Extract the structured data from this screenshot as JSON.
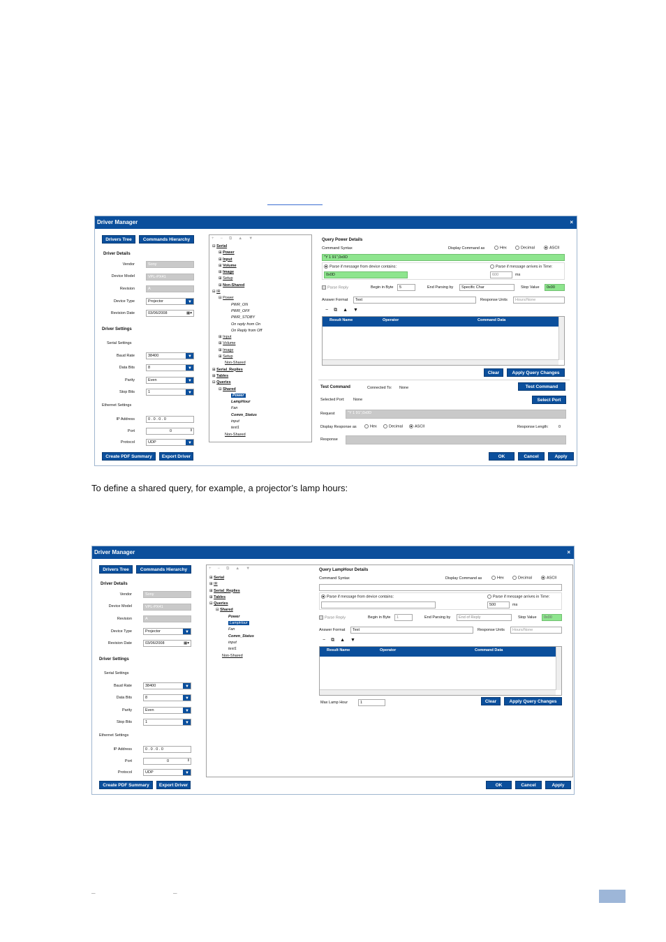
{
  "link_text": "",
  "intro_text": "To define a shared query, for example, a projector’s lamp hours:",
  "footer": {
    "left_a": "–",
    "left_b": "–"
  },
  "win1": {
    "title": "Driver Manager",
    "close": "×",
    "tab_drivers": "Drivers Tree",
    "tab_commands": "Commands Hierarchy",
    "driver_details": "Driver Details",
    "vendor_label": "Vendor",
    "vendor": "Sony",
    "model_label": "Device Model",
    "model": "VPL-PX41",
    "revision_label": "Revision",
    "revision": "A",
    "type_label": "Device Type",
    "type": "Projector",
    "date_label": "Revision Date",
    "date": "03/06/2008",
    "driver_settings": "Driver Settings",
    "serial_settings": "Serial Settings",
    "baud_label": "Baud Rate",
    "baud": "38400",
    "databits_label": "Data Bits",
    "databits": "8",
    "parity_label": "Parity",
    "parity": "Even",
    "stopbits_label": "Stop Bits",
    "stopbits": "1",
    "ethernet_settings": "Ethernet Settings",
    "ip_label": "IP Address",
    "ip": "0 . 0 . 0 . 0",
    "port_label": "Port",
    "port": "0",
    "protocol_label": "Protocol",
    "protocol": "UDP",
    "btn_pdf": "Create PDF Summary",
    "btn_export": "Export Driver",
    "tree": [
      "Serial",
      "Power",
      "Input",
      "Volume",
      "Image",
      "Setup",
      "Non-Shared",
      "IR",
      "Power",
      "PWR_ON",
      "PWR_OFF",
      "PWR_STDBY",
      "On reply from On",
      "On Reply from Off",
      "Input",
      "Volume",
      "Image",
      "Setup",
      "Non-Shared",
      "Serial_Replies",
      "Tables",
      "Queries",
      "Shared",
      "Power",
      "LampHour",
      "Fan",
      "Comm_Status",
      "input",
      "test1",
      "Non-Shared"
    ],
    "qd_title": "Query Power Details",
    "cmd_syntax": "Command Syntax",
    "display_as": "Display Command as",
    "hex": "Hex",
    "decimal": "Decimal",
    "ascii": "ASCII",
    "syntax_value": "\"Y 1 91\",0x0D",
    "parse_contains": "Parse if message from device contains:",
    "contains_value": "0x0D",
    "parse_time": "Parse if message arrives in Time:",
    "time_value": "600",
    "ms": "ms",
    "parse_reply": "Parse Reply",
    "begin_byte": "Begin in Byte",
    "begin_value": "5",
    "end_parsing": "End Parsing by",
    "end_value": "Specific Char",
    "stop_value_label": "Stop Value",
    "stop_value": "0x00",
    "answer_format": "Answer Format",
    "answer_value": "Text",
    "response_units": "Response Units",
    "response_value": "Hours/None",
    "col_result": "Result Name",
    "col_operator": "Operator",
    "col_data": "Command Data",
    "btn_clear": "Clear",
    "btn_apply_query": "Apply Query Changes",
    "test_command": "Test Command",
    "connected_to": "Connected To:",
    "connected_value": "None",
    "btn_test": "Test Command",
    "selected_port": "Selected Port:",
    "port_value": "None",
    "btn_select_port": "Select Port",
    "request_label": "Request",
    "request_value": "\"Y 1 91\",0x0D",
    "display_response": "Display Response as",
    "response_length": "Response Length:",
    "length_value": "0",
    "response_label": "Response",
    "btn_ok": "OK",
    "btn_cancel": "Cancel",
    "btn_apply": "Apply"
  },
  "win2": {
    "title": "Driver Manager",
    "close": "×",
    "tab_drivers": "Drivers Tree",
    "tab_commands": "Commands Hierarchy",
    "driver_details": "Driver Details",
    "vendor_label": "Vendor",
    "vendor": "Sony",
    "model_label": "Device Model",
    "model": "VPL-PX41",
    "revision_label": "Revision",
    "revision": "A",
    "type_label": "Device Type",
    "type": "Projector",
    "date_label": "Revision Date",
    "date": "03/06/2008",
    "driver_settings": "Driver Settings",
    "serial_settings": "Serial Settings",
    "baud_label": "Baud Rate",
    "baud": "38400",
    "databits_label": "Data Bits",
    "databits": "8",
    "parity_label": "Parity",
    "parity": "Even",
    "stopbits_label": "Stop Bits",
    "stopbits": "1",
    "ethernet_settings": "Ethernet Settings",
    "ip_label": "IP Address",
    "ip": "0 . 0 . 0 . 0",
    "port_label": "Port",
    "port": "0",
    "protocol_label": "Protocol",
    "protocol": "UDP",
    "btn_pdf": "Create PDF Summary",
    "btn_export": "Export Driver",
    "tree": [
      "Serial",
      "IR",
      "Serial_Replies",
      "Tables",
      "Queries",
      "Shared",
      "Power",
      "LampHour",
      "Fan",
      "Comm_Status",
      "input",
      "test1",
      "Non-Shared"
    ],
    "qd_title": "Query LampHour Details",
    "cmd_syntax": "Command Syntax",
    "display_as": "Display Command as",
    "hex": "Hex",
    "decimal": "Decimal",
    "ascii": "ASCII",
    "parse_contains": "Parse if message from device contains:",
    "parse_time": "Parse if message arrives in Time:",
    "time_value": "500",
    "ms": "ms",
    "parse_reply": "Parse Reply",
    "begin_byte": "Begin in Byte",
    "begin_value": "1",
    "end_parsing": "End Parsing by",
    "end_value": "End of Reply",
    "stop_value_label": "Stop Value",
    "stop_value": "0x00",
    "answer_format": "Answer Format",
    "answer_value": "Text",
    "response_units": "Response Units",
    "response_value": "Hours/None",
    "col_result": "Result Name",
    "col_operator": "Operator",
    "col_data": "Command Data",
    "btn_clear": "Clear",
    "btn_apply_query": "Apply Query Changes",
    "max_lamp": "Max Lamp Hour",
    "max_value": "1",
    "btn_ok": "OK",
    "btn_cancel": "Cancel",
    "btn_apply": "Apply"
  }
}
